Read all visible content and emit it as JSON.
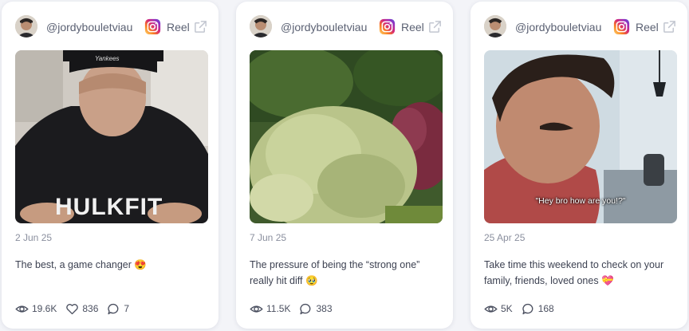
{
  "cards": [
    {
      "handle": "@jordybouletviau",
      "platform_icon": "instagram-icon",
      "type_label": "Reel",
      "external_icon": "external-link-icon",
      "thumbnail_text": "HULKFIT",
      "thumbnail_cap_text": "Yankees",
      "date": "2 Jun 25",
      "caption": "The best, a game changer 😍",
      "views": "19.6K",
      "likes": "836",
      "comments": "7"
    },
    {
      "handle": "@jordybouletviau",
      "platform_icon": "instagram-icon",
      "type_label": "Reel",
      "external_icon": "external-link-icon",
      "date": "7 Jun 25",
      "caption": "The pressure of being the “strong one” really hit diff 🥹",
      "views": "11.5K",
      "comments": "383"
    },
    {
      "handle": "@jordybouletviau",
      "platform_icon": "instagram-icon",
      "type_label": "Reel",
      "external_icon": "external-link-icon",
      "thumbnail_subtitle": "\"Hey bro how are you!?\"",
      "date": "25 Apr 25",
      "caption": "Take time this weekend to check on your family, friends, loved ones 💝",
      "views": "5K",
      "comments": "168"
    }
  ],
  "colors": {
    "background": "#f3f4f8",
    "card": "#ffffff",
    "text_muted": "#8a8f9e",
    "text_body": "#3d4252",
    "instagram_gradient": [
      "#feda75",
      "#fa7e1e",
      "#d62976",
      "#962fbf",
      "#4f5bd5"
    ]
  }
}
